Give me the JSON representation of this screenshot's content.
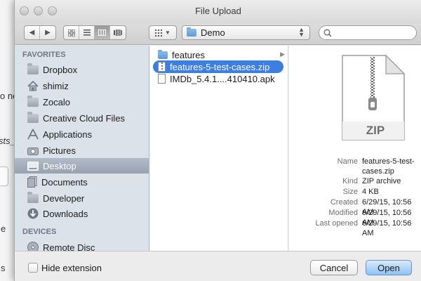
{
  "window": {
    "title": "File Upload"
  },
  "background": {
    "fragments": [
      "o nc",
      "sts_",
      "e",
      "s"
    ]
  },
  "toolbar": {
    "location": "Demo",
    "search_placeholder": ""
  },
  "sidebar": {
    "favorites_heading": "FAVORITES",
    "devices_heading": "DEVICES",
    "favorites": [
      {
        "label": "Dropbox",
        "icon": "folder-icon"
      },
      {
        "label": "shimiz",
        "icon": "home-icon"
      },
      {
        "label": "Zocalo",
        "icon": "folder-icon"
      },
      {
        "label": "Creative Cloud Files",
        "icon": "folder-icon"
      },
      {
        "label": "Applications",
        "icon": "applications-icon"
      },
      {
        "label": "Pictures",
        "icon": "camera-icon"
      },
      {
        "label": "Desktop",
        "icon": "desktop-icon",
        "selected": true
      },
      {
        "label": "Documents",
        "icon": "document-icon"
      },
      {
        "label": "Developer",
        "icon": "folder-icon"
      },
      {
        "label": "Downloads",
        "icon": "download-icon"
      }
    ],
    "devices": [
      {
        "label": "Remote Disc",
        "icon": "disc-icon"
      }
    ]
  },
  "files": [
    {
      "name": "features",
      "kind": "folder"
    },
    {
      "name": "features-5-test-cases.zip",
      "kind": "zip",
      "selected": true
    },
    {
      "name": "IMDb_5.4.1....410410.apk",
      "kind": "file"
    }
  ],
  "preview": {
    "icon_label": "ZIP",
    "name_key": "Name",
    "name_line1": "features-5-test-",
    "name_line2": "cases.zip",
    "kind_key": "Kind",
    "kind": "ZIP archive",
    "size_key": "Size",
    "size": "4 KB",
    "created_key": "Created",
    "created": "6/29/15, 10:56 AM",
    "modified_key": "Modified",
    "modified": "6/29/15, 10:56 AM",
    "opened_key": "Last opened",
    "opened": "6/29/15, 10:56 AM"
  },
  "bottom": {
    "hide_extension": "Hide extension",
    "cancel": "Cancel",
    "open": "Open"
  },
  "colors": {
    "selection": "#3d7ee1",
    "sidebar": "#dce2ea",
    "primary_button": "#8fc1f4"
  }
}
